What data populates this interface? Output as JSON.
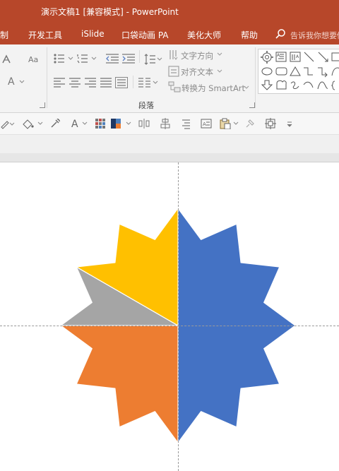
{
  "window": {
    "title": "演示文稿1 [兼容模式]  -  PowerPoint"
  },
  "menu": {
    "items": [
      {
        "label": "制"
      },
      {
        "label": "开发工具"
      },
      {
        "label": "iSlide"
      },
      {
        "label": "口袋动画 PA"
      },
      {
        "label": "美化大师"
      },
      {
        "label": "帮助"
      }
    ],
    "tell_me": "告诉我你想要做什么"
  },
  "ribbon": {
    "text_direction": "文字方向",
    "align_text": "对齐文本",
    "convert_smartart": "转换为 SmartArt",
    "paragraph_group": "段落"
  },
  "colors": {
    "title_bar": "#b7472a",
    "slice_blue": "#4472c4",
    "slice_orange": "#ed7d31",
    "slice_gray": "#a5a5a5",
    "slice_yellow": "#ffc000"
  },
  "shape": {
    "type": "12-point star split into pie segments",
    "segments": [
      {
        "color": "blue",
        "share": 0.5
      },
      {
        "color": "orange",
        "share": 0.25
      },
      {
        "color": "gray",
        "share": 0.1
      },
      {
        "color": "yellow",
        "share": 0.15
      }
    ]
  }
}
